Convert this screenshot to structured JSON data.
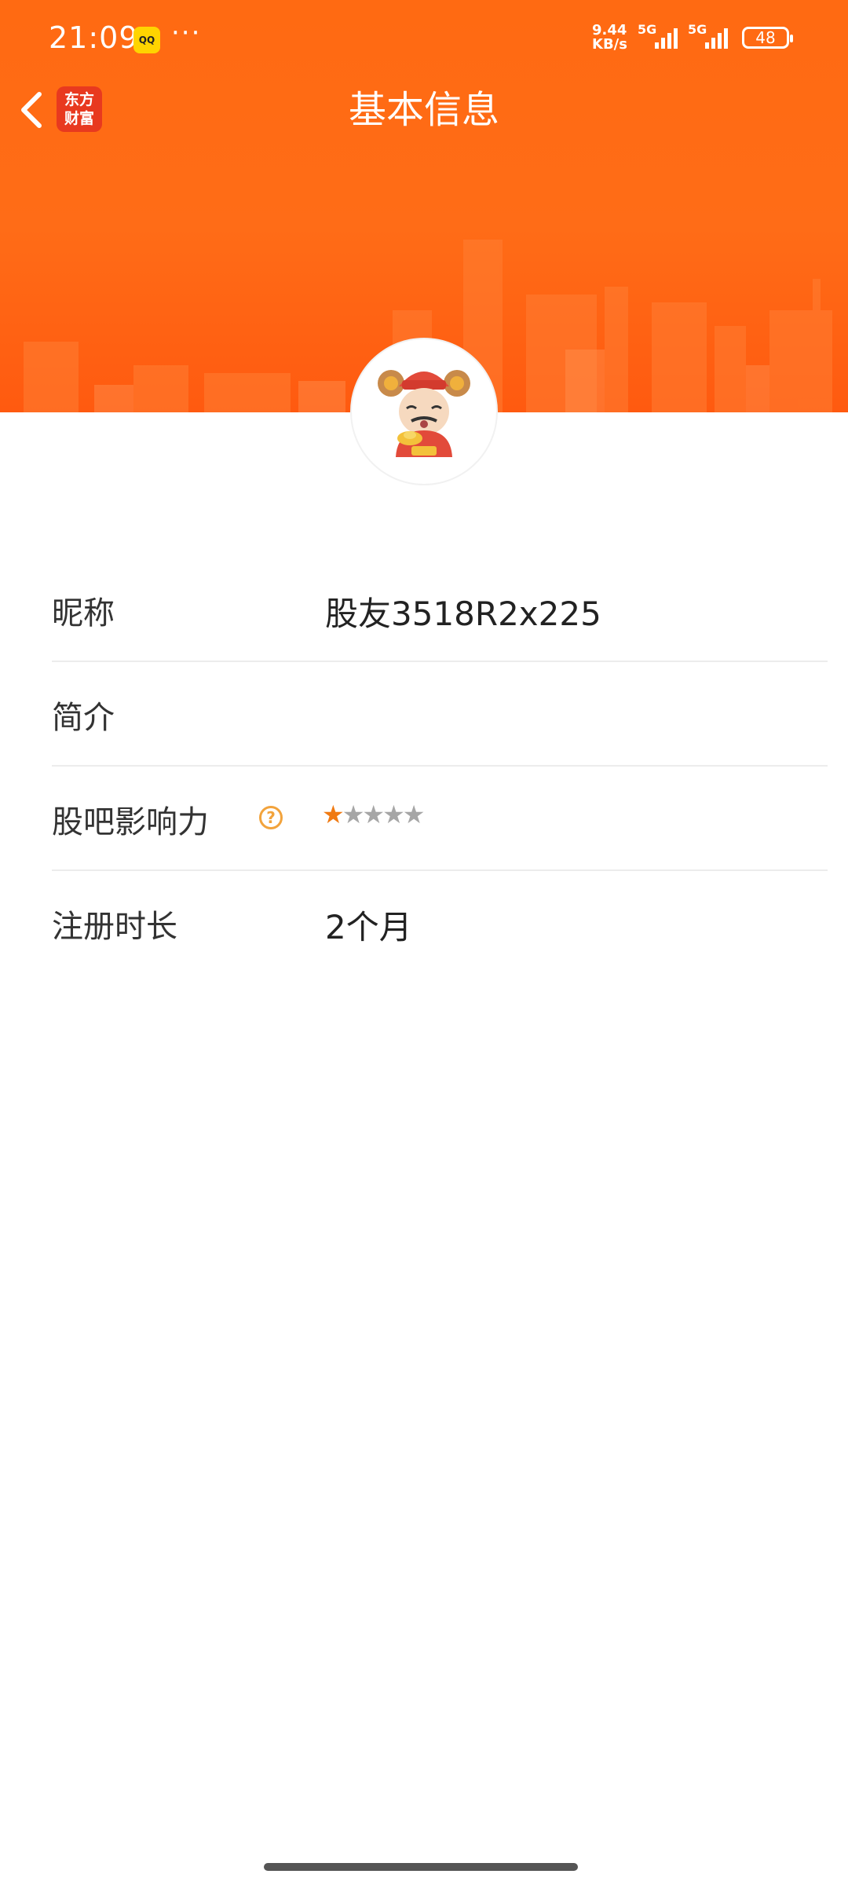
{
  "status_bar": {
    "time": "21:09",
    "app_badge": "QQ",
    "more": "···",
    "net_speed_value": "9.44",
    "net_speed_unit": "KB/s",
    "sim1": "5G",
    "sim2": "5G",
    "battery": "48"
  },
  "nav": {
    "back_icon": "chevron-left-icon",
    "logo_line1": "东方",
    "logo_line2": "财富",
    "title": "基本信息"
  },
  "colors": {
    "header": "#ff6a12",
    "accent": "#f07a12",
    "help": "#f2a33c"
  },
  "profile": {
    "rows": [
      {
        "label": "昵称",
        "value": "股友3518R2x225"
      },
      {
        "label": "简介",
        "value": ""
      },
      {
        "label": "股吧影响力",
        "help": "?",
        "rating": 1,
        "max_rating": 5,
        "stars_on": "★",
        "stars_off": "★★★★"
      },
      {
        "label": "注册时长",
        "value": "2个月"
      }
    ]
  }
}
